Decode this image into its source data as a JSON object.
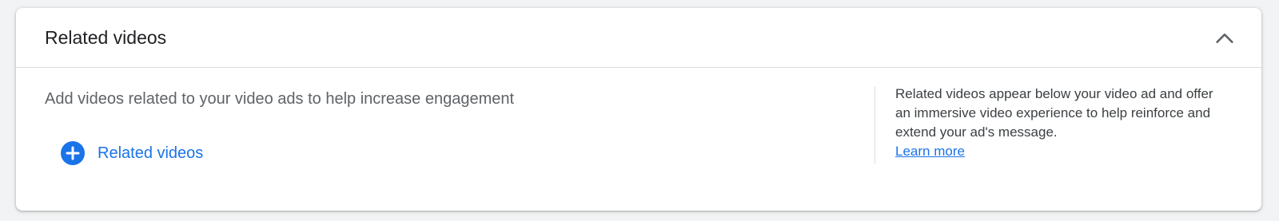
{
  "section": {
    "title": "Related videos",
    "collapse_icon": "chevron-up-icon",
    "description": "Add videos related to your video ads to help increase engagement",
    "add_button": {
      "icon": "add-circle-icon",
      "label": "Related videos"
    },
    "help": {
      "text": "Related videos appear below your video ad and offer an immersive video experience to help reinforce and extend your ad's message.",
      "link_label": "Learn more"
    }
  },
  "colors": {
    "accent": "#1a73e8",
    "background": "#f1f3f4",
    "card": "#ffffff",
    "divider": "#dadce0"
  }
}
